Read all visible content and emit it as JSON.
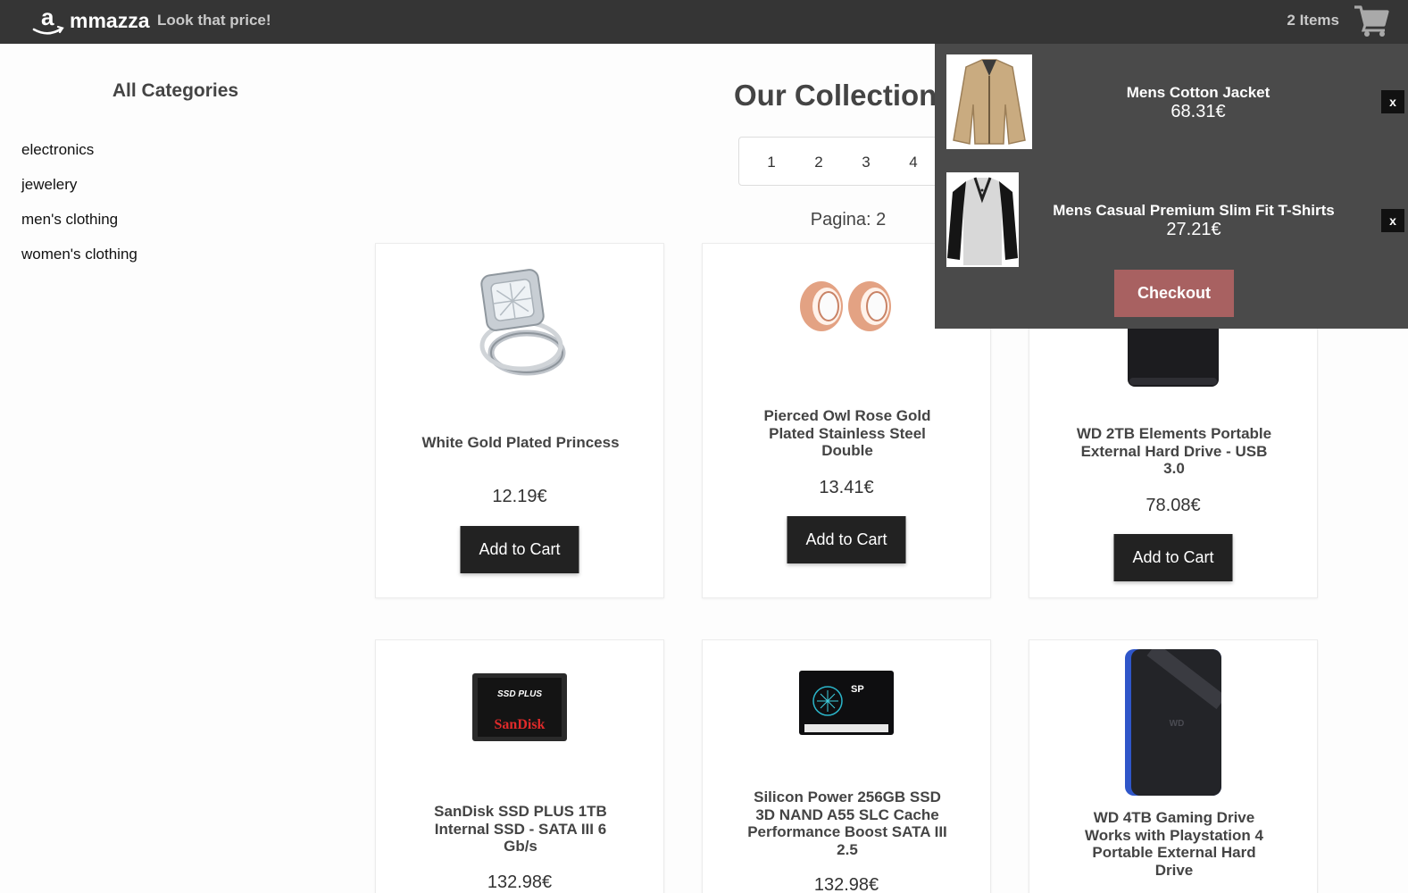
{
  "header": {
    "logo_letter": "a",
    "brand": "mmazza",
    "tagline": "Look that price!",
    "item_count": "2 Items"
  },
  "sidebar": {
    "title": "All Categories",
    "categories": [
      {
        "label": "electronics"
      },
      {
        "label": "jewelery"
      },
      {
        "label": "men's clothing"
      },
      {
        "label": "women's clothing"
      }
    ]
  },
  "main": {
    "title": "Our Collections",
    "pages": [
      "1",
      "2",
      "3",
      "4"
    ],
    "page_label": "Pagina: 2",
    "add_to_cart_label": "Add to Cart",
    "products": [
      {
        "title": "White Gold Plated Princess",
        "price": "12.19€",
        "image_icon": "ring-icon"
      },
      {
        "title": "Pierced Owl Rose Gold Plated Stainless Steel Double",
        "price": "13.41€",
        "image_icon": "ear-tunnels-icon"
      },
      {
        "title": "WD 2TB Elements Portable External Hard Drive - USB 3.0",
        "price": "78.08€",
        "image_icon": "hard-drive-icon"
      },
      {
        "title": "SanDisk SSD PLUS 1TB Internal SSD - SATA III 6 Gb/s",
        "price": "132.98€",
        "image_icon": "ssd-icon",
        "image_text_1": "SSD PLUS",
        "image_text_2": "SanDisk"
      },
      {
        "title": "Silicon Power 256GB SSD 3D NAND A55 SLC Cache Performance Boost SATA III 2.5",
        "price": "132.98€",
        "image_icon": "ssd-icon",
        "image_text_1": "SP"
      },
      {
        "title": "WD 4TB Gaming Drive Works with Playstation 4 Portable External Hard Drive",
        "price": "",
        "image_icon": "gaming-drive-icon",
        "image_text_1": "WD"
      }
    ]
  },
  "cart": {
    "items": [
      {
        "name": "Mens Cotton Jacket",
        "price": "68.31€",
        "image_icon": "jacket-icon"
      },
      {
        "name": "Mens Casual Premium Slim Fit T-Shirts",
        "price": "27.21€",
        "image_icon": "tshirt-icon"
      }
    ],
    "remove_label": "x",
    "checkout_label": "Checkout"
  },
  "colors": {
    "header_bg": "#353535",
    "cart_panel_bg": "#4a4a4a",
    "checkout_bg": "#a86161",
    "button_bg": "#222222"
  }
}
